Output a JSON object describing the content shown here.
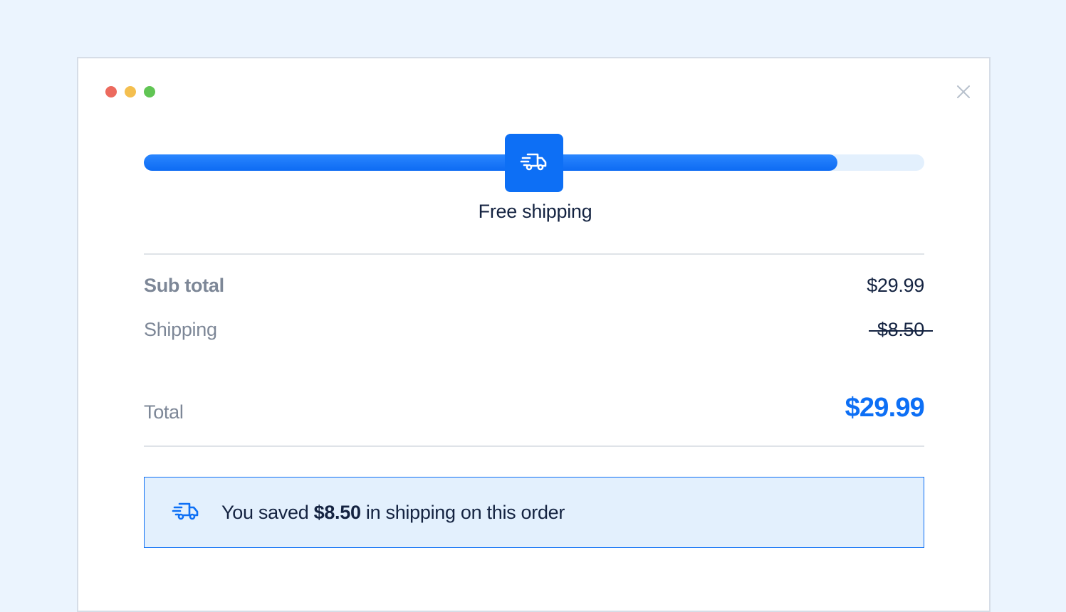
{
  "window": {
    "controls": [
      "close-dot",
      "minimize-dot",
      "maximize-dot"
    ],
    "close_icon": "close-icon"
  },
  "progress": {
    "fraction": 0.889,
    "badge_icon": "truck-icon",
    "label": "Free shipping",
    "fill_color": "#0d6ff5",
    "track_color": "#e3f0fd"
  },
  "summary": {
    "subtotal_label": "Sub total",
    "subtotal_value": "$29.99",
    "shipping_label": "Shipping",
    "shipping_value": "$8.50",
    "total_label": "Total",
    "total_value": "$29.99",
    "accent_color": "#0d6ff5"
  },
  "notice": {
    "icon": "truck-icon",
    "prefix": "You saved ",
    "amount": "$8.50",
    "suffix": " in shipping on this order"
  }
}
